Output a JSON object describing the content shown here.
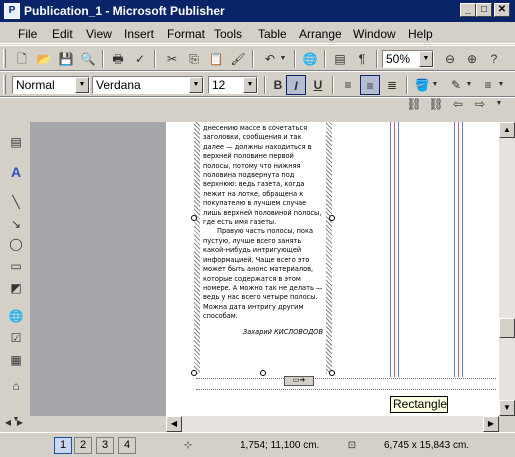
{
  "window": {
    "title": "Publication_1 - Microsoft Publisher",
    "app_icon": "publisher-icon"
  },
  "menu": [
    "File",
    "Edit",
    "View",
    "Insert",
    "Format",
    "Tools",
    "Table",
    "Arrange",
    "Window",
    "Help"
  ],
  "standard_toolbar": {
    "zoom": "50%"
  },
  "formatting_toolbar": {
    "style": "Normal",
    "font": "Verdana",
    "size": "12",
    "bold_label": "B",
    "italic_label": "I",
    "underline_label": "U"
  },
  "document": {
    "paragraphs": [
      "днесению массе в сочетаться заголовки, сообщения и так далее — должны находиться в верхней половине первой полосы, потому что нижняя половина подвернута под верхнюю: ведь газета, когда лежит на лотке, обращена к покупателю в лучшем случае лишь верхней половиной полосы, где есть имя газеты.",
      "Правую часть полосы, пока пустую, лучше всего занять какой-нибудь интригующей информацией. Чаще всего это может быть анонс материалов, которые содержатся в этом номере. А можно так не делать — ведь у нас всего четыре полосы. Можна дата интригу другим способам."
    ],
    "signature": "Захарий КИСЛОВОДОВ"
  },
  "tooltip": "Rectangle",
  "statusbar": {
    "pages": [
      "1",
      "2",
      "3",
      "4"
    ],
    "position": "1,754; 11,100 cm.",
    "size": "6,745 x 15,843 cm."
  }
}
